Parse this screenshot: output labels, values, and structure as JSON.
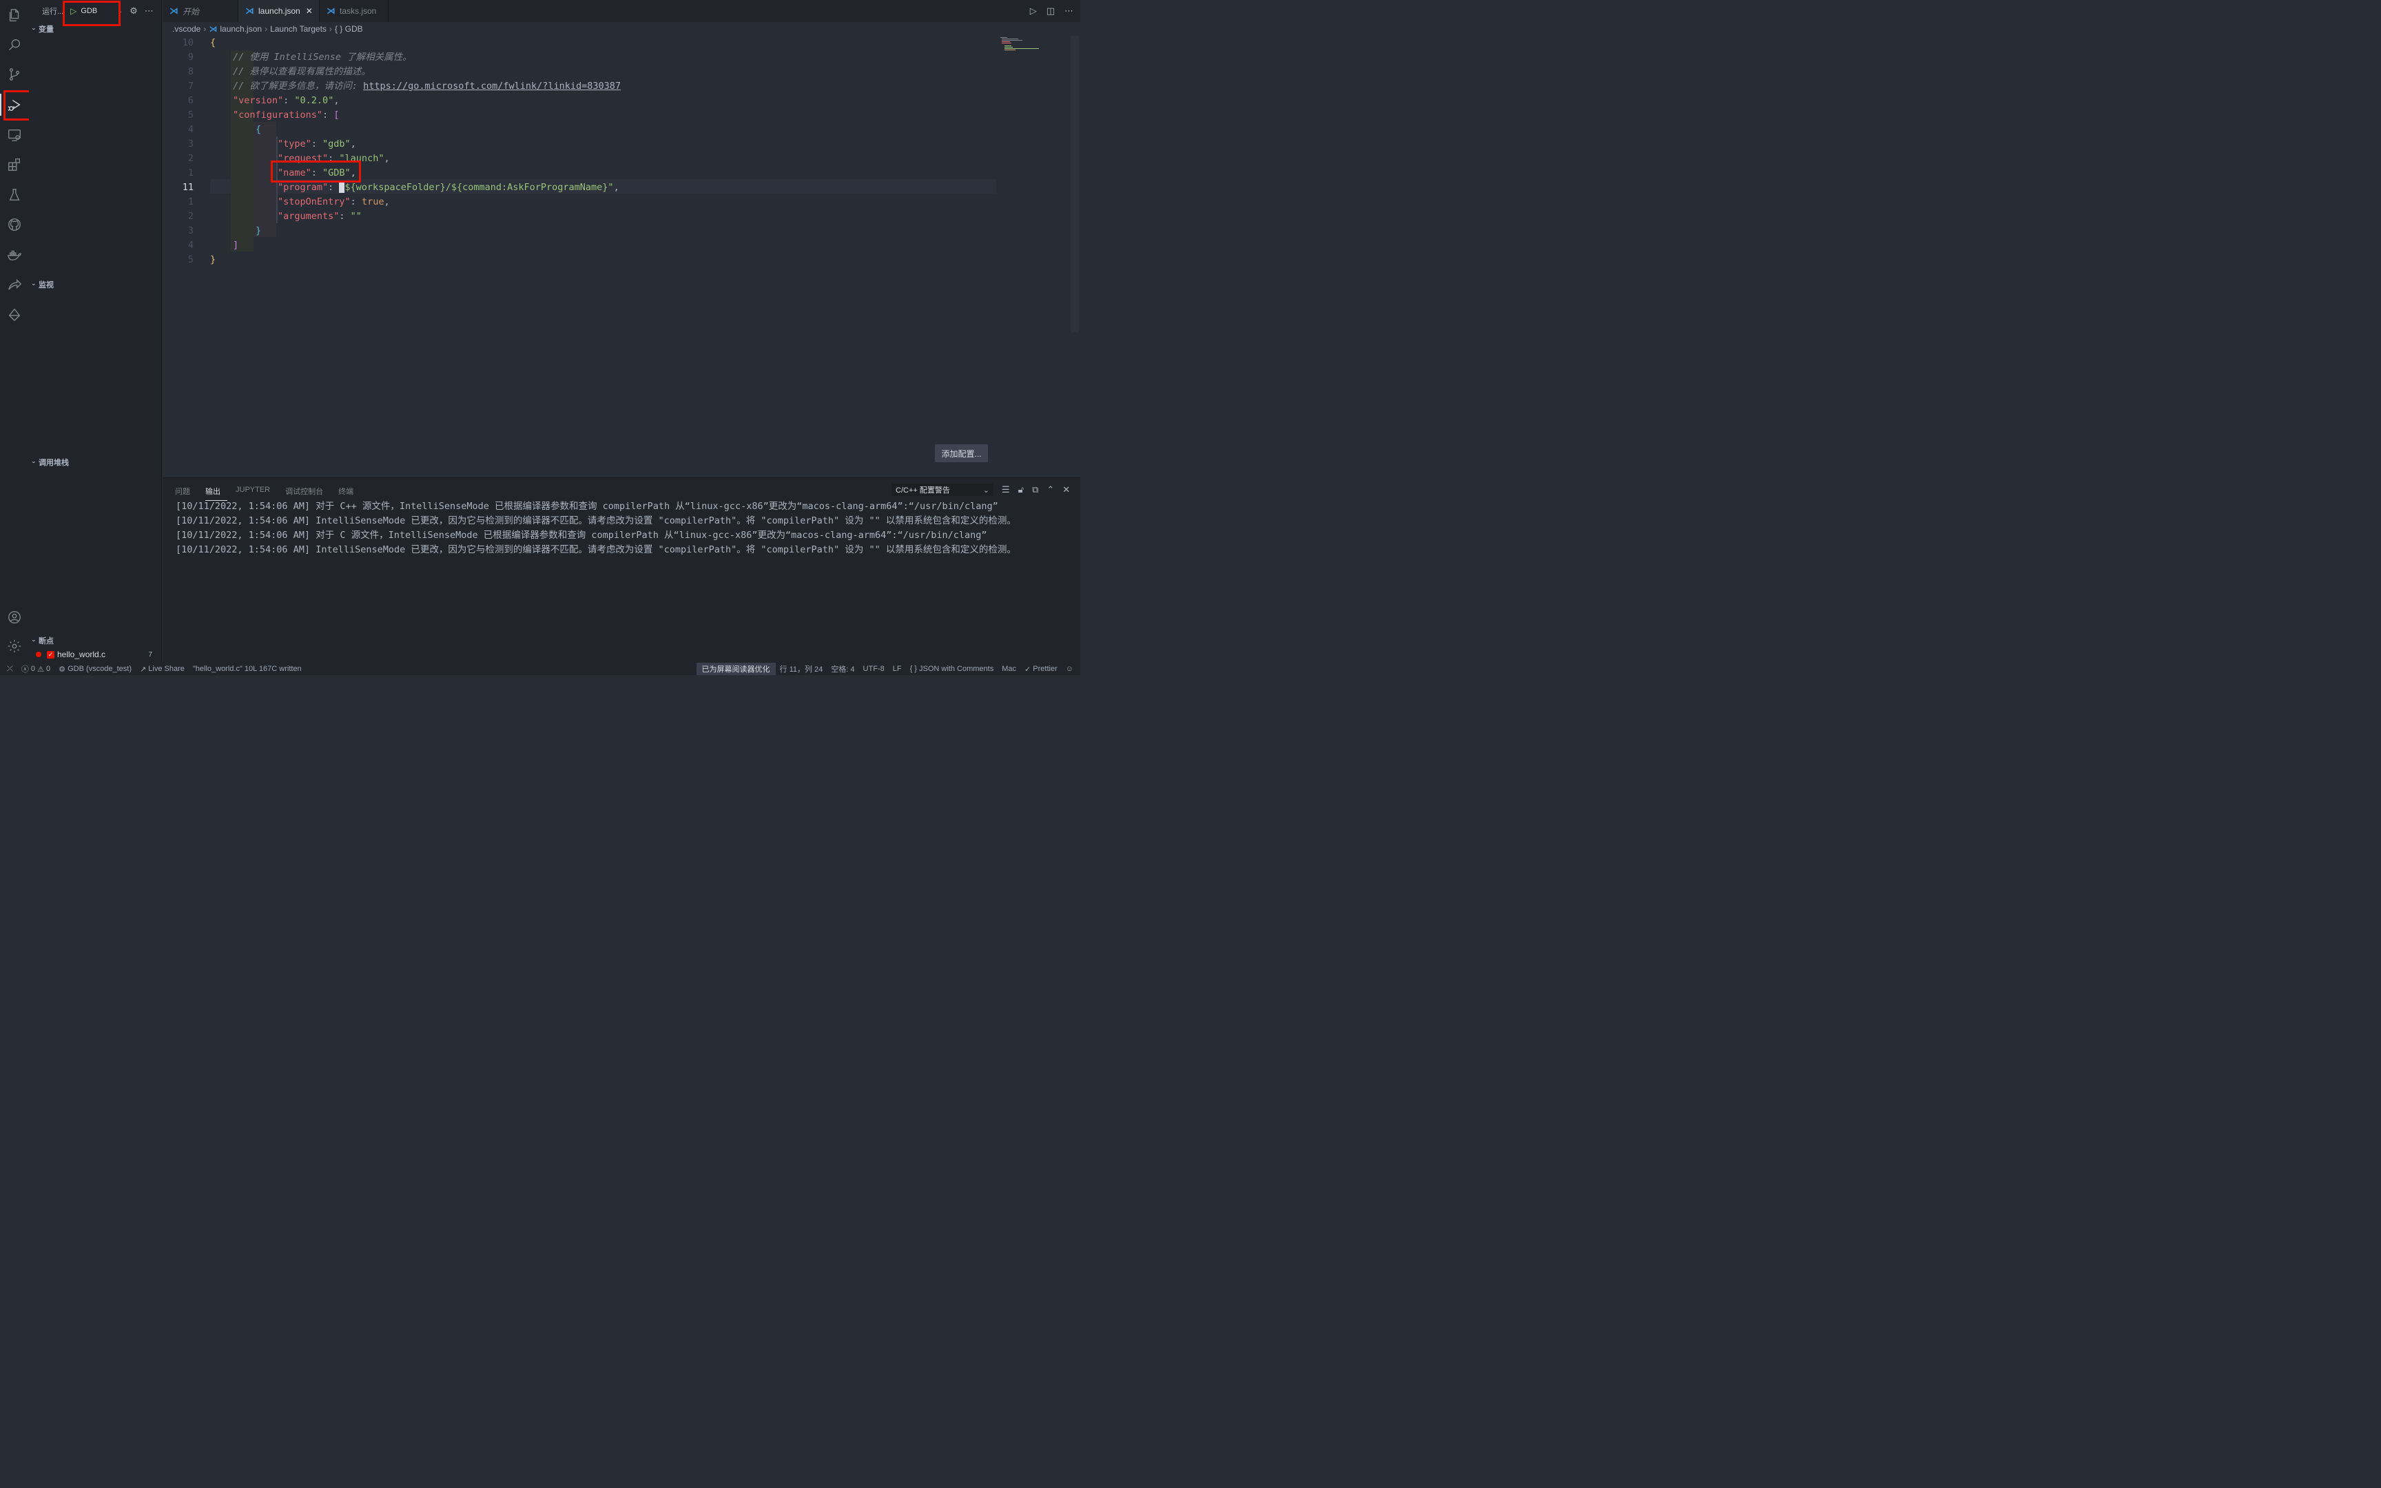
{
  "sidebar": {
    "run_label": "运行...",
    "config_name": "GDB",
    "sections": {
      "variables": "变量",
      "watch": "监视",
      "call_stack": "调用堆栈",
      "breakpoints": "断点"
    },
    "breakpoint_file": "hello_world.c",
    "breakpoint_count": "7"
  },
  "tabs": [
    {
      "label": "开始"
    },
    {
      "label": "launch.json"
    },
    {
      "label": "tasks.json"
    }
  ],
  "breadcrumb": {
    "folder": ".vscode",
    "file": "launch.json",
    "section": "Launch Targets",
    "item": "{ } GDB"
  },
  "editor": {
    "line_numbers": [
      "10",
      "9",
      "8",
      "7",
      "6",
      "5",
      "4",
      "3",
      "2",
      "1",
      "11",
      "1",
      "2",
      "3",
      "4",
      "5"
    ],
    "comment1": "// 使用 IntelliSense 了解相关属性。",
    "comment2": "// 悬停以查看现有属性的描述。",
    "comment3_prefix": "// 欲了解更多信息，请访问: ",
    "comment3_url": "https://go.microsoft.com/fwlink/?linkid=830387",
    "version_key": "\"version\"",
    "version_val": "\"0.2.0\"",
    "configurations_key": "\"configurations\"",
    "type_key": "\"type\"",
    "type_val": "\"gdb\"",
    "request_key": "\"request\"",
    "request_val": "\"launch\"",
    "name_key": "\"name\"",
    "name_val": "\"GDB\"",
    "program_key": "\"program\"",
    "program_val": "${workspaceFolder}/${command:AskForProgramName}\"",
    "stop_key": "\"stopOnEntry\"",
    "stop_val": "true",
    "args_key": "\"arguments\"",
    "args_val": "\"\"",
    "add_config_button": "添加配置..."
  },
  "panel": {
    "tabs": [
      "问题",
      "输出",
      "JUPYTER",
      "调试控制台",
      "终端"
    ],
    "channel": "C/C++ 配置警告",
    "output_lines": [
      "[10/11/2022, 1:54:06 AM] 对于 C++ 源文件，IntelliSenseMode 已根据编译器参数和查询 compilerPath 从“linux-gcc-x86”更改为“macos-clang-arm64”:“/usr/bin/clang”",
      "[10/11/2022, 1:54:06 AM] IntelliSenseMode 已更改，因为它与检测到的编译器不匹配。请考虑改为设置 \"compilerPath\"。将 \"compilerPath\" 设为 \"\" 以禁用系统包含和定义的检测。",
      "[10/11/2022, 1:54:06 AM] 对于 C 源文件，IntelliSenseMode 已根据编译器参数和查询 compilerPath 从“linux-gcc-x86”更改为“macos-clang-arm64”:“/usr/bin/clang”",
      "[10/11/2022, 1:54:06 AM] IntelliSenseMode 已更改，因为它与检测到的编译器不匹配。请考虑改为设置 \"compilerPath\"。将 \"compilerPath\" 设为 \"\" 以禁用系统包含和定义的检测。"
    ]
  },
  "status": {
    "errors": "0",
    "warnings": "0",
    "debug_target": "GDB (vscode_test)",
    "live_share": "Live Share",
    "message": "\"hello_world.c\" 10L 167C written",
    "screen_reader": "已为屏幕阅读器优化",
    "position": "行 11，列 24",
    "spaces": "空格: 4",
    "encoding": "UTF-8",
    "eol": "LF",
    "language": "JSON with Comments",
    "os": "Mac",
    "formatter": "Prettier"
  },
  "colors": {
    "highlight_box": "#e51400",
    "vscode_blue": "#3a95e0"
  }
}
